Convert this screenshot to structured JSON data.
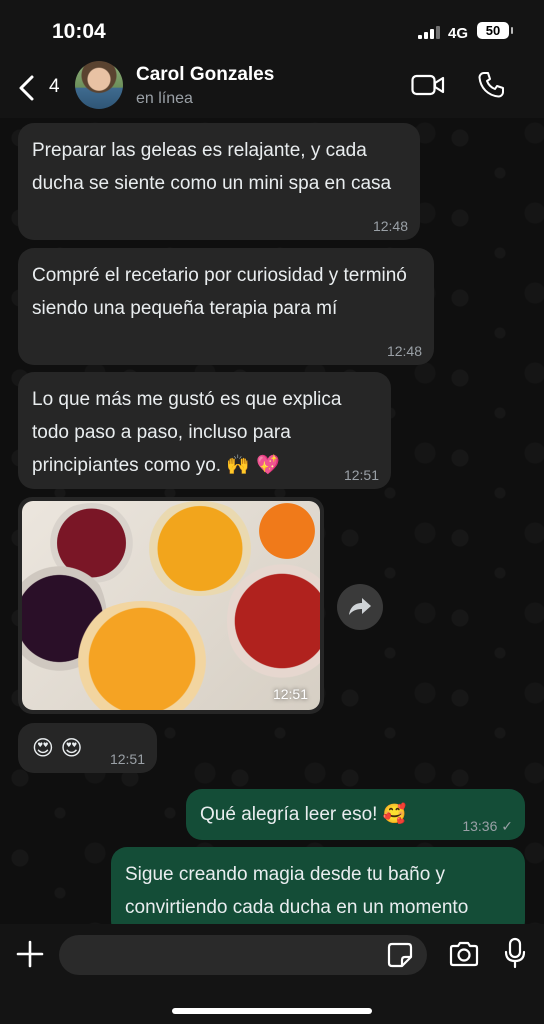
{
  "status_bar": {
    "time": "10:04",
    "network": "4G",
    "battery": "50"
  },
  "header": {
    "back_count": "4",
    "contact_name": "Carol Gonzales",
    "contact_status": "en línea"
  },
  "messages": [
    {
      "direction": "incoming",
      "text": "Preparar las geleas es relajante, y cada ducha se siente como un mini spa en casa",
      "time": "12:48"
    },
    {
      "direction": "incoming",
      "text": "Compré el recetario por curiosidad y terminó siendo una pequeña terapia para mí",
      "time": "12:48"
    },
    {
      "direction": "incoming",
      "text": "Lo que más me gustó es que explica todo paso a paso, incluso para principiantes como yo.",
      "emoji": "🙌 💖",
      "time": "12:51"
    },
    {
      "direction": "incoming",
      "type": "image",
      "description_icon": "jam-jars-photo",
      "time": "12:51"
    },
    {
      "direction": "incoming",
      "emoji": "😍 😍",
      "time": "12:51"
    },
    {
      "direction": "outgoing",
      "text": "Qué alegría leer eso!",
      "emoji": "🥰",
      "time": "13:36",
      "status": "✓"
    },
    {
      "direction": "outgoing",
      "text": "Sigue creando magia desde tu baño y convirtiendo cada ducha en un momento"
    }
  ],
  "input": {
    "placeholder": ""
  },
  "colors": {
    "incoming_bubble": "#262626",
    "outgoing_bubble": "#144d37",
    "background": "#0f0f0f"
  }
}
